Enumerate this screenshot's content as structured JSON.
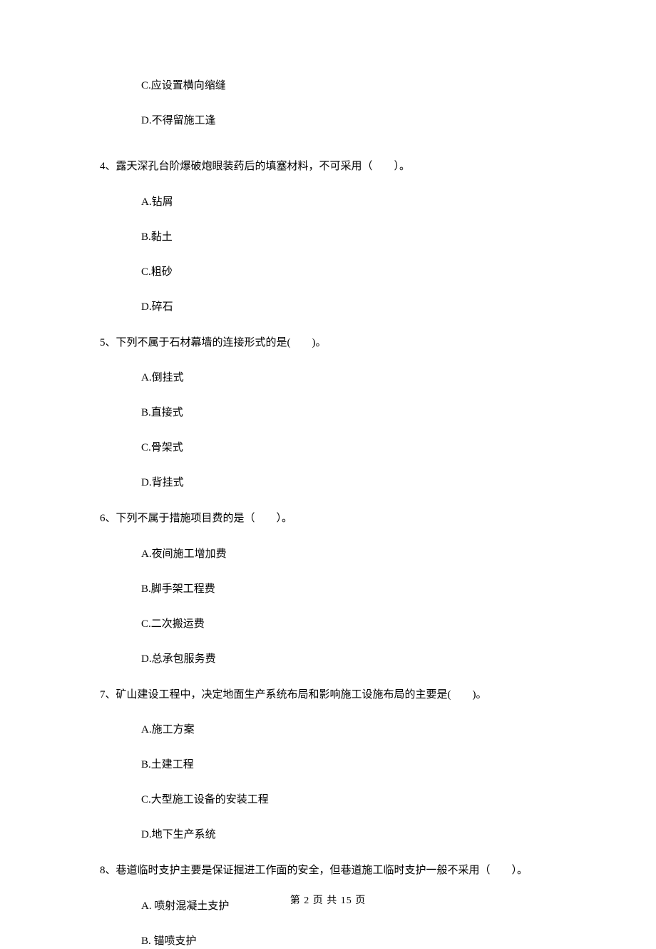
{
  "orphanOptions": {
    "c": "C.应设置横向缩缝",
    "d": "D.不得留施工逢"
  },
  "questions": [
    {
      "stem": "4、露天深孔台阶爆破炮眼装药后的填塞材料，不可采用（　　）。",
      "options": [
        "A.钻屑",
        "B.黏土",
        "C.粗砂",
        "D.碎石"
      ]
    },
    {
      "stem": "5、下列不属于石材幕墙的连接形式的是(　　)。",
      "options": [
        "A.倒挂式",
        "B.直接式",
        "C.骨架式",
        "D.背挂式"
      ]
    },
    {
      "stem": "6、下列不属于措施项目费的是（　　）。",
      "options": [
        "A.夜间施工增加费",
        "B.脚手架工程费",
        "C.二次搬运费",
        "D.总承包服务费"
      ]
    },
    {
      "stem": "7、矿山建设工程中，决定地面生产系统布局和影响施工设施布局的主要是(　　)。",
      "options": [
        "A.施工方案",
        "B.土建工程",
        "C.大型施工设备的安装工程",
        "D.地下生产系统"
      ]
    },
    {
      "stem": "8、巷道临时支护主要是保证掘进工作面的安全，但巷道施工临时支护一般不采用（　　）。",
      "options": [
        "A. 喷射混凝土支护",
        "B. 锚喷支护"
      ]
    }
  ],
  "footer": "第 2 页 共 15 页"
}
